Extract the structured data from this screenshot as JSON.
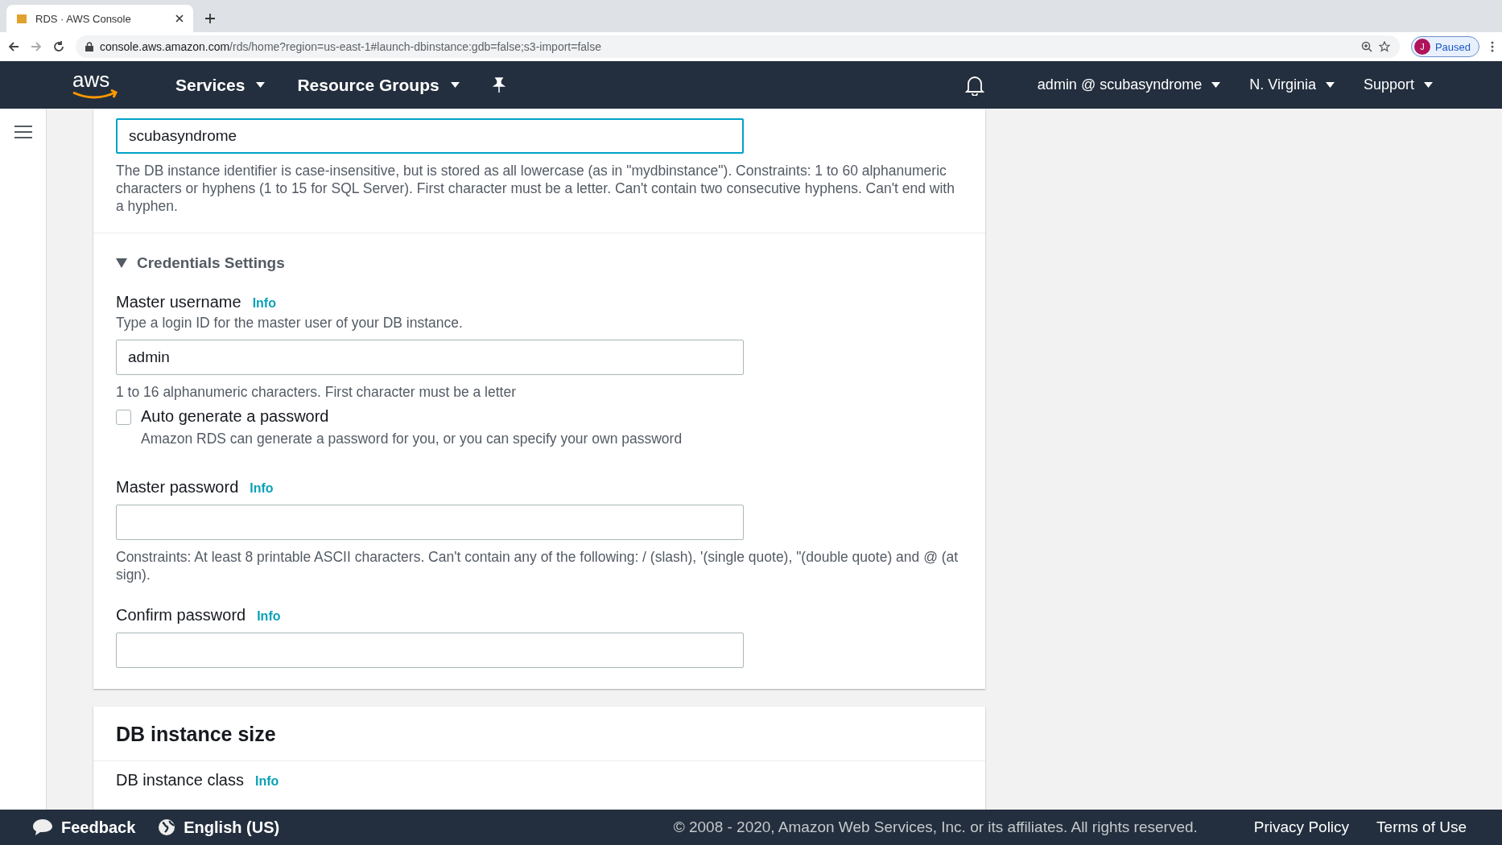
{
  "logo": {
    "text": "aws"
  },
  "browser": {
    "tab_title": "RDS · AWS Console",
    "url_host": "console.aws.amazon.com",
    "url_path": "/rds/home?region=us-east-1#launch-dbinstance:gdb=false;s3-import=false",
    "profile_initial": "J",
    "profile_status": "Paused"
  },
  "nav": {
    "menus": [
      {
        "label": "Services"
      },
      {
        "label": "Resource Groups"
      }
    ],
    "account": [
      {
        "label": "admin @ scubasyndrome"
      },
      {
        "label": "N. Virginia"
      },
      {
        "label": "Support"
      }
    ]
  },
  "identifier": {
    "value": "scubasyndrome",
    "focused": true,
    "help": "The DB instance identifier is case-insensitive, but is stored as all lowercase (as in \"mydbinstance\"). Constraints: 1 to 60 alphanumeric characters or hyphens (1 to 15 for SQL Server). First character must be a letter. Can't contain two consecutive hyphens. Can't end with a hyphen."
  },
  "credentials": {
    "title": "Credentials Settings",
    "expanded": true,
    "username": {
      "label": "Master username",
      "info": "Info",
      "description": "Type a login ID for the master user of your DB instance.",
      "value": "admin",
      "hint": "1 to 16 alphanumeric characters. First character must be a letter"
    },
    "auto_generate": {
      "label": "Auto generate a password",
      "description": "Amazon RDS can generate a password for you, or you can specify your own password",
      "checked": false
    },
    "password": {
      "label": "Master password",
      "info": "Info",
      "hint": "Constraints: At least 8 printable ASCII characters. Can't contain any of the following: / (slash), '(single quote), \"(double quote) and @ (at sign)."
    },
    "confirm": {
      "label": "Confirm password",
      "info": "Info"
    }
  },
  "size": {
    "title": "DB instance size",
    "field_label": "DB instance class",
    "info": "Info"
  },
  "footer": {
    "feedback": "Feedback",
    "language": "English (US)",
    "copyright": "© 2008 - 2020, Amazon Web Services, Inc. or its affiliates. All rights reserved.",
    "links": [
      "Privacy Policy",
      "Terms of Use"
    ]
  }
}
